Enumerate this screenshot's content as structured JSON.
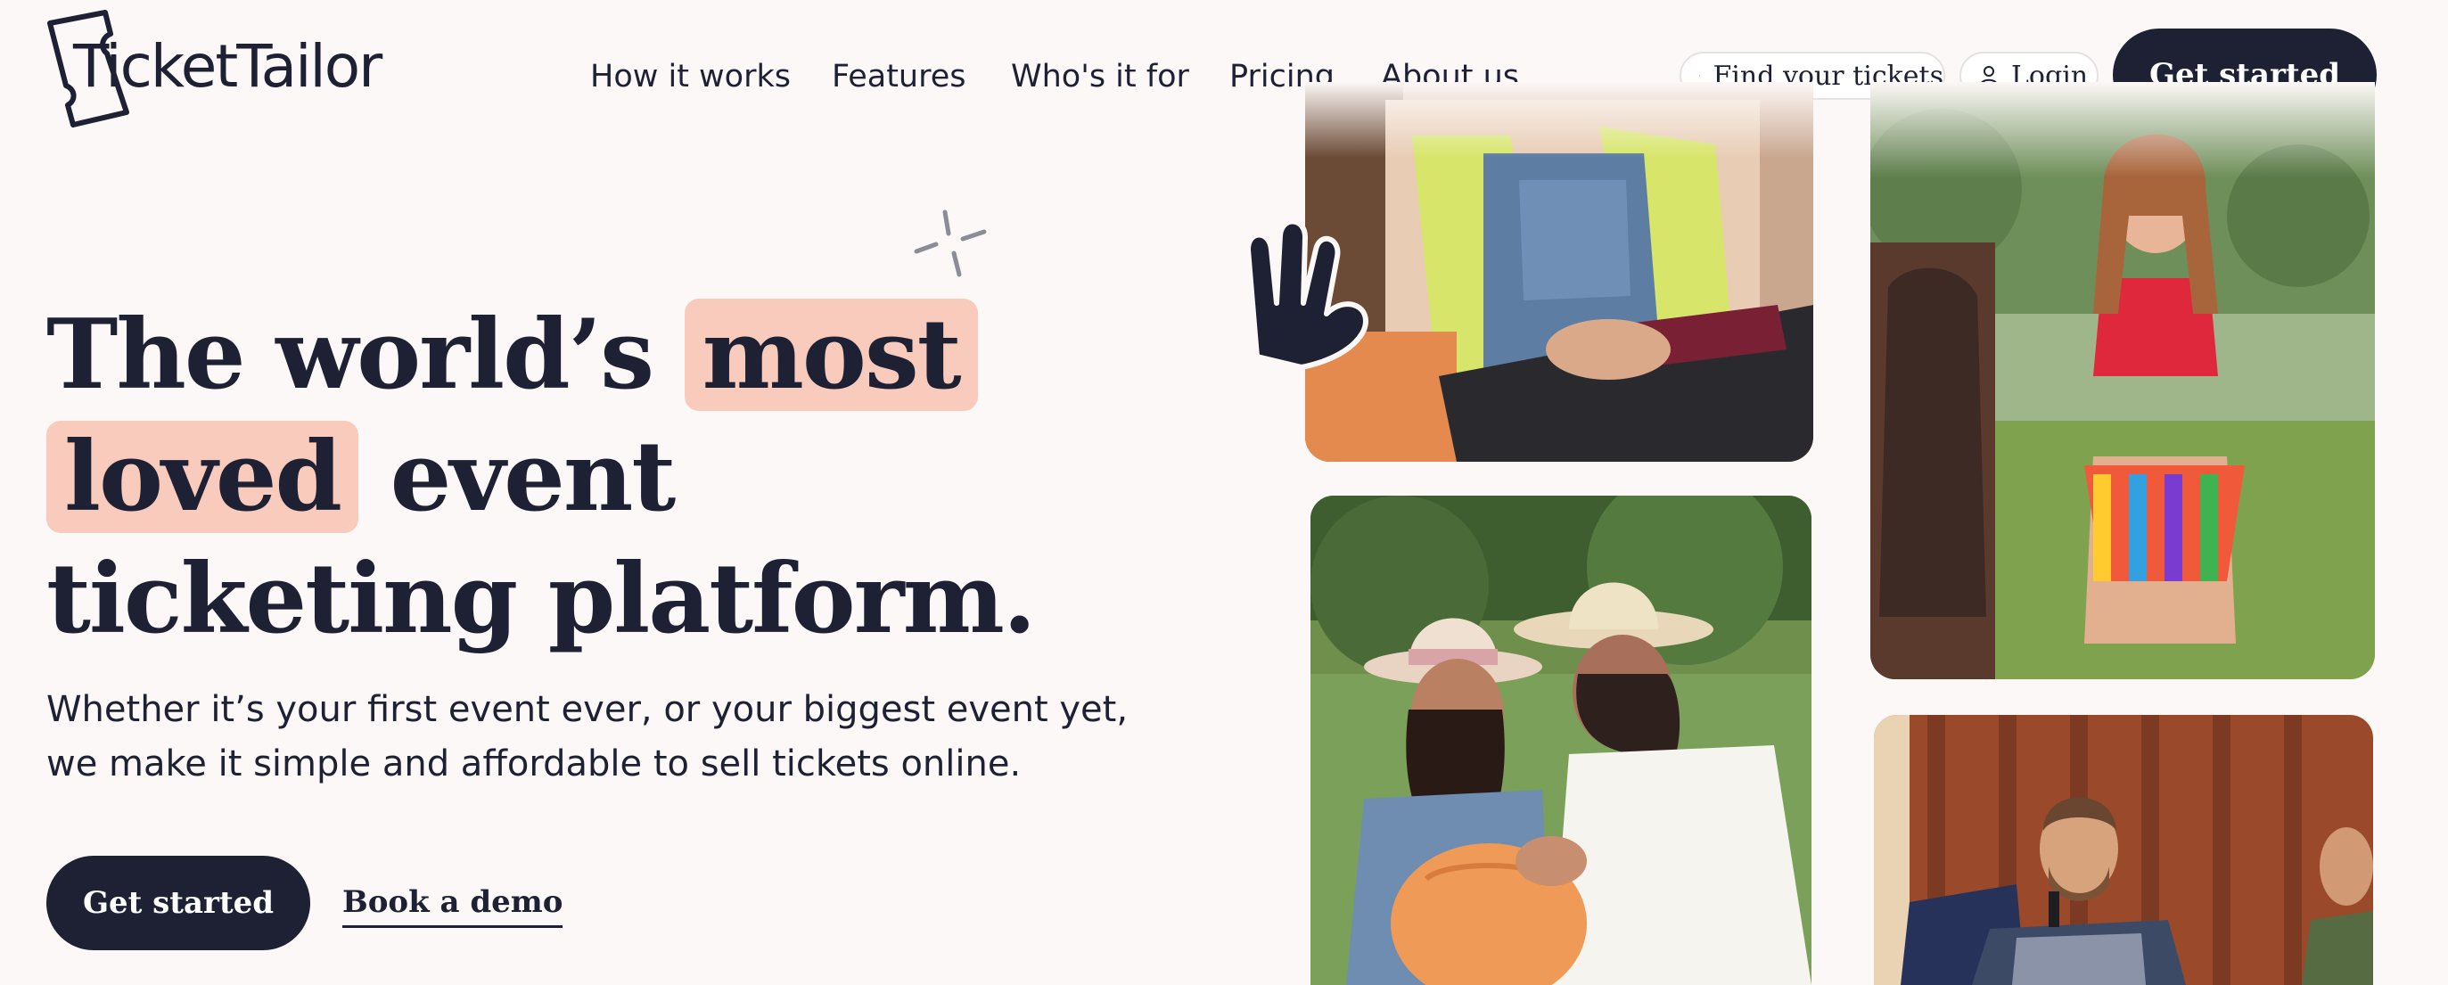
{
  "brand": {
    "name": "TicketTailor"
  },
  "nav": {
    "items": [
      "How it works",
      "Features",
      "Who's it for",
      "Pricing",
      "About us"
    ]
  },
  "header": {
    "find_tickets": "Find your tickets",
    "login": "Login",
    "get_started": "Get started"
  },
  "hero": {
    "headline_part1": "The world’s ",
    "headline_highlight1": "most",
    "headline_highlight2": "loved",
    "headline_part2": " event",
    "headline_line3": "ticketing platform.",
    "subtext_line1": "Whether it’s your first event ever, or your biggest event yet,",
    "subtext_line2": "we make it simple and affordable to sell tickets online.",
    "primary_cta": "Get started",
    "secondary_cta": "Book a demo"
  },
  "colors": {
    "navy": "#1e2133",
    "highlight": "#f8cbbd",
    "background": "#fcf8f7"
  },
  "icons": [
    "ticket-logo-icon",
    "ticket-icon",
    "user-icon",
    "sparkle-icon",
    "ok-hand-icon"
  ]
}
